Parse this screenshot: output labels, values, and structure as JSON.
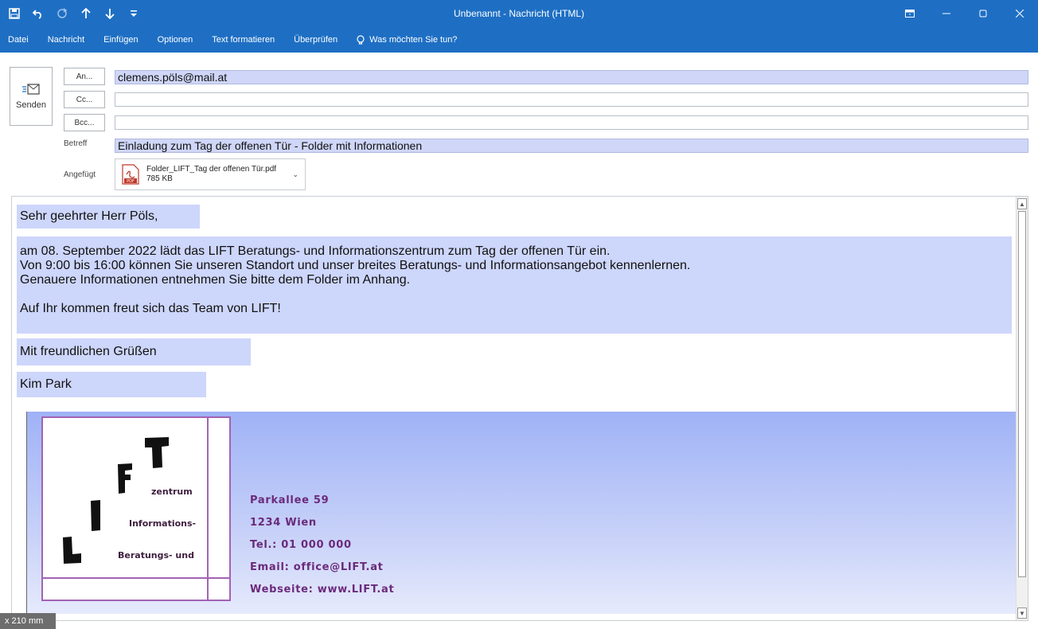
{
  "window": {
    "title": "Unbenannt - Nachricht (HTML)",
    "qat_icons": [
      "save-icon",
      "undo-icon",
      "redo-icon",
      "up-arrow-icon",
      "down-arrow-icon",
      "customize-icon"
    ],
    "controls": [
      "ribbon-display-icon",
      "minimize-icon",
      "restore-icon",
      "close-icon"
    ],
    "accent": "#1e6fc4"
  },
  "ribbon": {
    "tabs": [
      "Datei",
      "Nachricht",
      "Einfügen",
      "Optionen",
      "Text formatieren",
      "Überprüfen"
    ],
    "tell_me": "Was möchten Sie tun?"
  },
  "header": {
    "send_label": "Senden",
    "to_button": "An...",
    "cc_button": "Cc...",
    "bcc_button": "Bcc...",
    "to_value": "clemens.pöls@mail.at",
    "cc_value": "",
    "bcc_value": "",
    "subject_label": "Betreff",
    "subject_value": "Einladung zum Tag der offenen Tür - Folder mit Informationen",
    "attached_label": "Angefügt",
    "attachment": {
      "name": "Folder_LIFT_Tag der offenen Tür.pdf",
      "size": "785 KB"
    }
  },
  "body": {
    "greeting": "Sehr geehrter Herr Pöls,",
    "lines": [
      "am 08. September 2022 lädt das LIFT Beratungs- und Informationszentrum zum Tag der offenen Tür ein.",
      "Von 9:00 bis 16:00 können Sie unseren Standort und unser breites Beratungs- und Informationsangebot kennenlernen.",
      "Genauere Informationen entnehmen Sie bitte dem Folder im Anhang."
    ],
    "closing_line": "Auf Ihr kommen freut sich das Team von LIFT!",
    "regards": "Mit freundlichen Grüßen",
    "name": "Kim Park"
  },
  "signature": {
    "logo_words": [
      "zentrum",
      "Informations-",
      "Beratungs- und"
    ],
    "lines": [
      "Parkallee 59",
      "1234 Wien",
      "Tel.: 01 000 000",
      "Email: office@LIFT.at",
      "Webseite: www.LIFT.at"
    ]
  },
  "status": {
    "badge": "x 210 mm"
  }
}
